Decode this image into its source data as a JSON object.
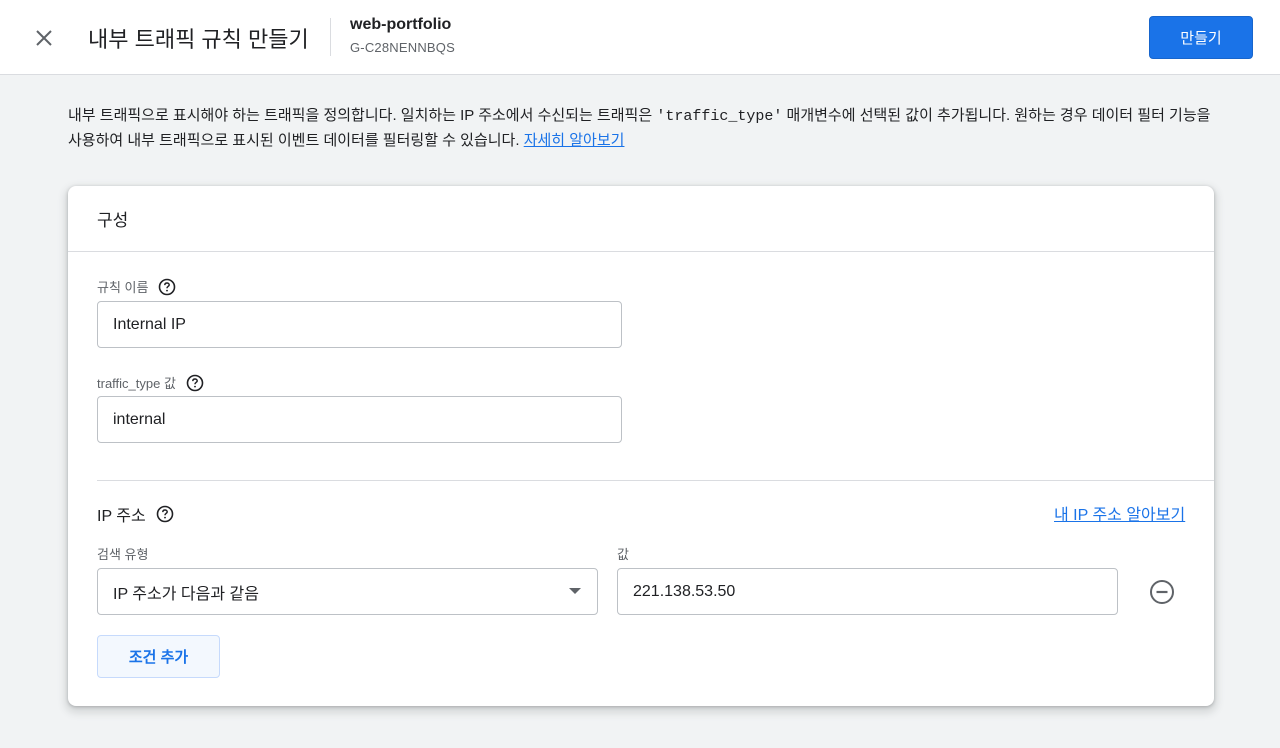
{
  "header": {
    "title": "내부 트래픽 규칙 만들기",
    "stream_name": "web-portfolio",
    "stream_id": "G-C28NENNBQS",
    "create_label": "만들기"
  },
  "description": {
    "text_before_code": "내부 트래픽으로 표시해야 하는 트래픽을 정의합니다. 일치하는 IP 주소에서 수신되는 트래픽은 ",
    "code": "'traffic_type'",
    "text_after_code": " 매개변수에 선택된 값이 추가됩니다. 원하는 경우 데이터 필터 기능을 사용하여 내부 트래픽으로 표시된 이벤트 데이터를 필터링할 수 있습니다. ",
    "learn_more": "자세히 알아보기"
  },
  "card": {
    "title": "구성",
    "rule_name": {
      "label": "규칙 이름",
      "value": "Internal IP"
    },
    "traffic_type": {
      "label": "traffic_type 값",
      "value": "internal"
    },
    "ip_section": {
      "title": "IP 주소",
      "find_my_ip": "내 IP 주소 알아보기",
      "match_type_label": "검색 유형",
      "match_type_value": "IP 주소가 다음과 같음",
      "value_label": "값",
      "value": "221.138.53.50",
      "add_condition": "조건 추가"
    }
  },
  "colors": {
    "primary": "#1a73e8",
    "background": "#f1f3f4",
    "border": "#dadce0"
  }
}
